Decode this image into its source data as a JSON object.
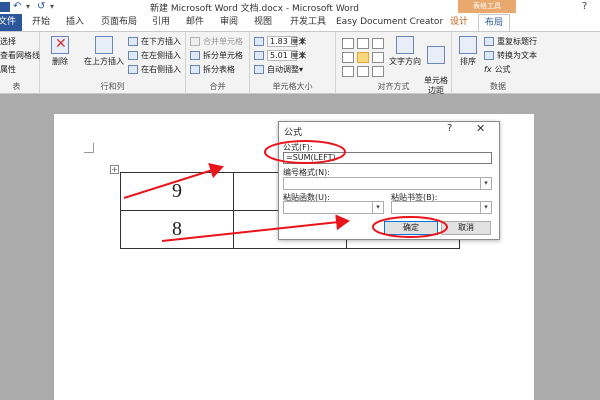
{
  "window": {
    "title": "新建 Microsoft Word 文档.docx - Microsoft Word",
    "context_tab_group": "表格工具",
    "help": "?"
  },
  "quick_access": {
    "undo": "↶",
    "redo": "↺",
    "more": "▾"
  },
  "tabs": [
    {
      "label": "文件"
    },
    {
      "label": "开始"
    },
    {
      "label": "插入"
    },
    {
      "label": "页面布局"
    },
    {
      "label": "引用"
    },
    {
      "label": "邮件"
    },
    {
      "label": "审阅"
    },
    {
      "label": "视图"
    },
    {
      "label": "开发工具"
    },
    {
      "label": "Easy Document Creator"
    },
    {
      "label": "设计"
    },
    {
      "label": "布局"
    }
  ],
  "ribbon": {
    "table_group": {
      "select": "选择",
      "gridlines": "查看网格线",
      "properties": "属性",
      "label": "表"
    },
    "rows_cols": {
      "delete": "删除",
      "insert_above": "在上方插入",
      "insert_below": "在下方插入",
      "insert_left": "在左侧插入",
      "insert_right": "在右侧插入",
      "label": "行和列"
    },
    "merge": {
      "merge_cells": "合并单元格",
      "split_cells": "拆分单元格",
      "split_table": "拆分表格",
      "label": "合并"
    },
    "cell_size": {
      "height": "1.83 厘米",
      "width": "5.01 厘米",
      "autofit": "自动调整",
      "label": "单元格大小"
    },
    "alignment": {
      "text_direction": "文字方向",
      "cell_margins": "单元格\n边距",
      "label": "对齐方式"
    },
    "data": {
      "sort": "排序",
      "repeat_header": "重复标题行",
      "convert_to_text": "转换为文本",
      "formula": "公式",
      "formula_icon": "fx",
      "label": "数据"
    }
  },
  "table": {
    "rows": [
      [
        "9",
        "",
        ""
      ],
      [
        "8",
        "",
        ""
      ]
    ]
  },
  "dialog": {
    "title": "公式",
    "help": "?",
    "close": "✕",
    "formula_label": "公式(F):",
    "formula_value": "=SUM(LEFT)",
    "number_format_label": "编号格式(N):",
    "number_format_value": "",
    "paste_function_label": "粘贴函数(U):",
    "paste_bookmark_label": "粘贴书签(B):",
    "ok_label": "确定",
    "cancel_label": "取消"
  },
  "colors": {
    "word_blue": "#2b579a",
    "annotation_red": "#e8141c",
    "context_orange": "#e8a86e"
  }
}
